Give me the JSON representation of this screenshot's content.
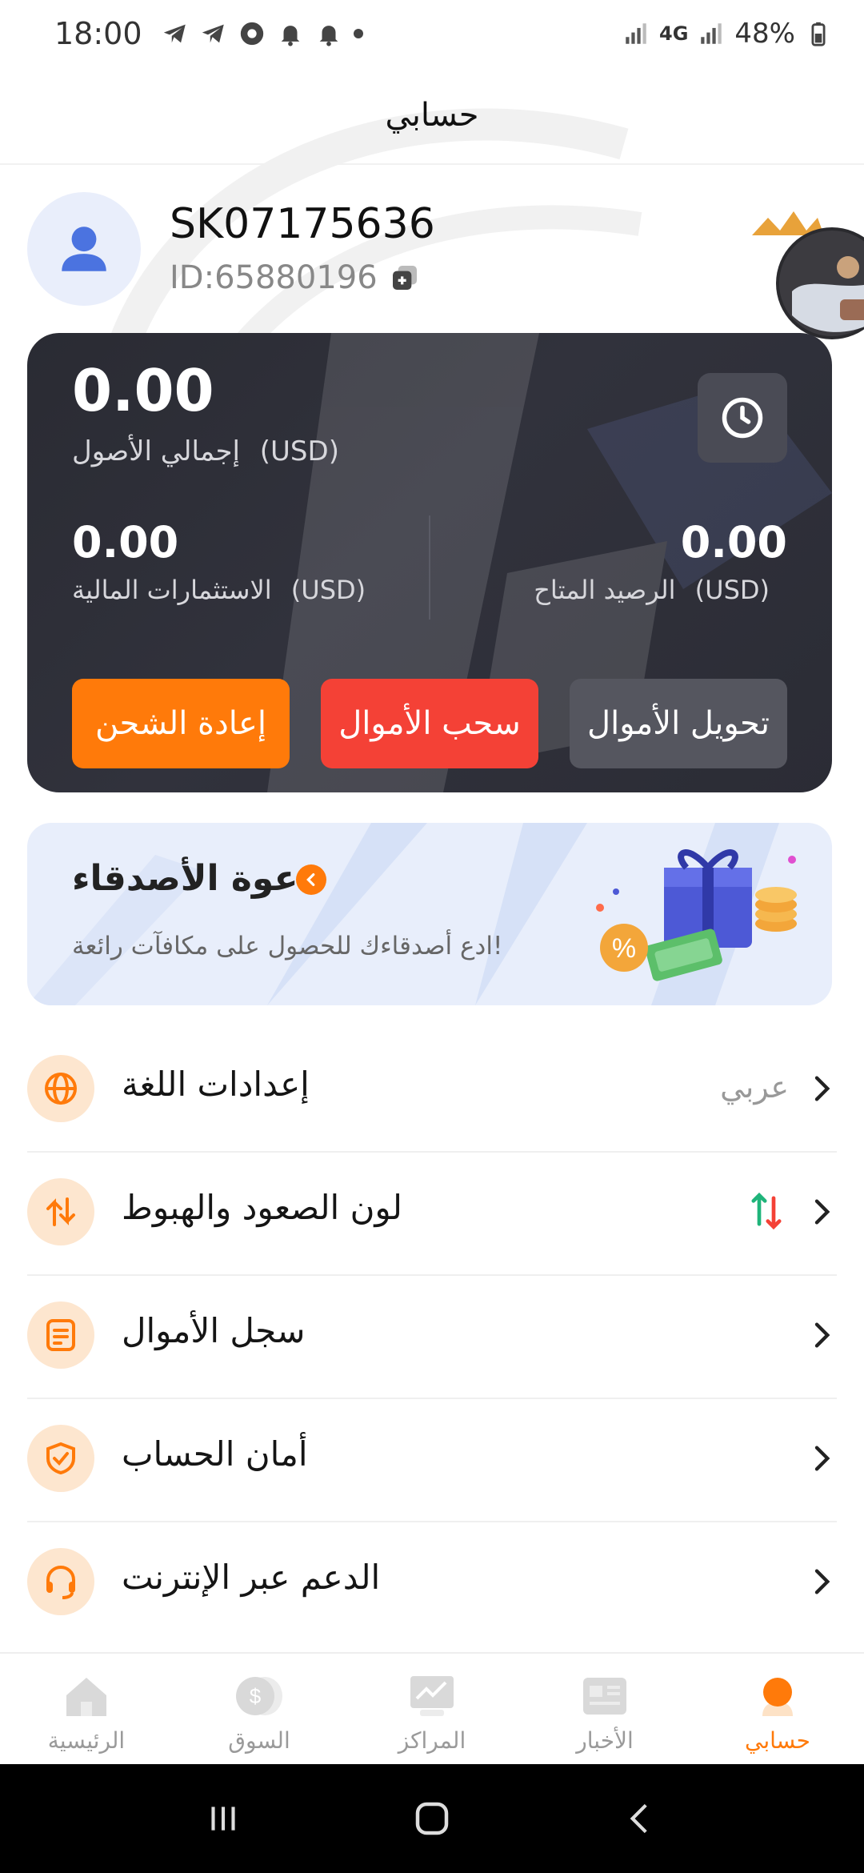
{
  "status_bar": {
    "time": "18:00",
    "network": "4G",
    "battery": "48%"
  },
  "header": {
    "title": "حسابي"
  },
  "profile": {
    "username": "SK07175636",
    "user_id": "ID:65880196"
  },
  "assets": {
    "total_value": "0.00",
    "total_label": "إجمالي الأصول",
    "currency": "(USD)",
    "available_value": "0.00",
    "available_label": "الرصيد المتاح",
    "investments_value": "0.00",
    "investments_label": "الاستثمارات المالية",
    "recharge_label": "إعادة الشحن",
    "withdraw_label": "سحب الأموال",
    "transfer_label": "تحويل الأموال"
  },
  "invite": {
    "title": "دعوة الأصدقاء",
    "subtitle": "ادع أصدقاءك للحصول على مكافآت رائعة!"
  },
  "menu": [
    {
      "label": "إعدادات اللغة",
      "value": "عربي",
      "icon": "globe-icon"
    },
    {
      "label": "لون الصعود والهبوط",
      "value": "",
      "icon": "arrows-updown-icon"
    },
    {
      "label": "سجل الأموال",
      "value": "",
      "icon": "document-icon"
    },
    {
      "label": "أمان الحساب",
      "value": "",
      "icon": "shield-check-icon"
    },
    {
      "label": "الدعم عبر الإنترنت",
      "value": "",
      "icon": "headset-icon"
    }
  ],
  "bottom_nav": [
    {
      "label": "الرئيسية",
      "icon": "home-icon"
    },
    {
      "label": "السوق",
      "icon": "market-icon"
    },
    {
      "label": "المراكز",
      "icon": "positions-icon"
    },
    {
      "label": "الأخبار",
      "icon": "news-icon"
    },
    {
      "label": "حسابي",
      "icon": "profile-icon",
      "active": true
    }
  ],
  "colors": {
    "accent": "#ff7a0a",
    "withdraw": "#f44136",
    "card": "#2e2f38",
    "icon_bg": "#fde6cf"
  }
}
